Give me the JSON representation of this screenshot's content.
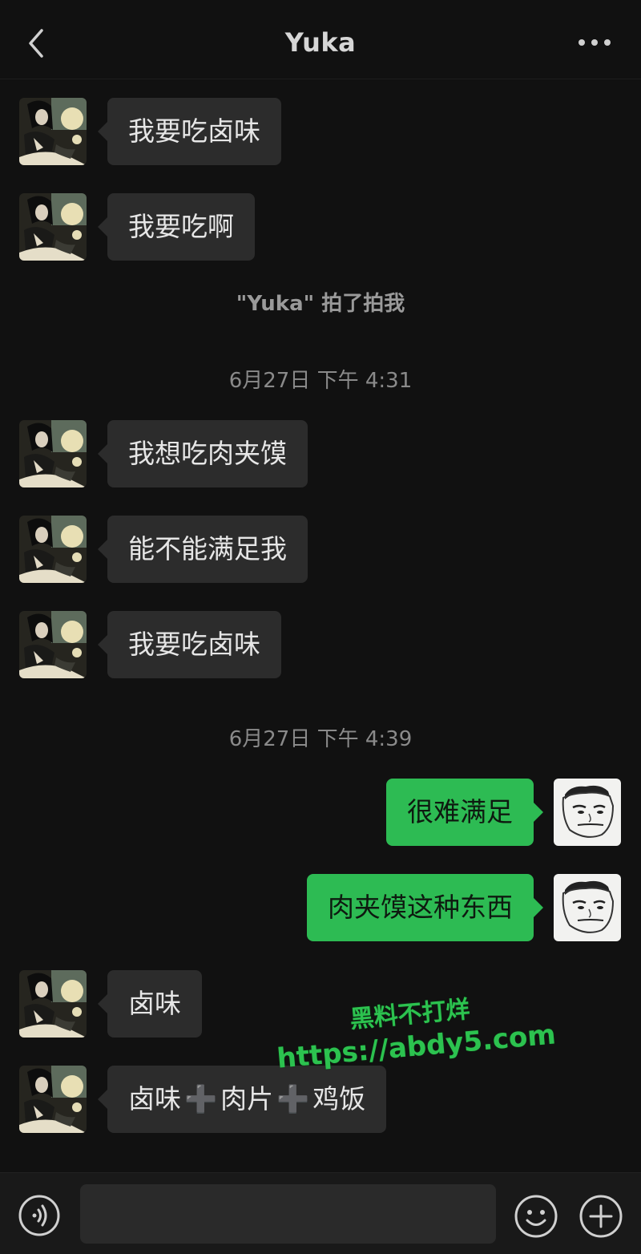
{
  "header": {
    "title": "Yuka",
    "back_icon": "chevron-left-icon",
    "more_icon": "more-dots-icon"
  },
  "messages": [
    {
      "type": "in",
      "text": "我要吃卤味"
    },
    {
      "type": "in",
      "text": "我要吃啊"
    },
    {
      "type": "system",
      "text": "\"Yuka\" 拍了拍我"
    },
    {
      "type": "time",
      "text": "6月27日 下午 4:31"
    },
    {
      "type": "in",
      "text": "我想吃肉夹馍"
    },
    {
      "type": "in",
      "text": "能不能满足我"
    },
    {
      "type": "in",
      "text": "我要吃卤味"
    },
    {
      "type": "time",
      "text": "6月27日 下午 4:39"
    },
    {
      "type": "out",
      "text": "很难满足"
    },
    {
      "type": "out",
      "text": "肉夹馍这种东西"
    },
    {
      "type": "in",
      "text": "卤味"
    },
    {
      "type": "in",
      "parts": [
        "卤味",
        "➕",
        "肉片",
        "➕",
        "鸡饭"
      ]
    }
  ],
  "watermark": {
    "line1": "黑料不打烊",
    "line2": "https://abdy5.com"
  },
  "footer": {
    "voice_icon": "voice-icon",
    "emoji_icon": "emoji-icon",
    "add_icon": "plus-circle-icon",
    "input_value": ""
  },
  "colors": {
    "background": "#111111",
    "incoming_bubble": "#2c2c2c",
    "outgoing_bubble": "#2dbb53",
    "watermark": "#2cc24f"
  }
}
